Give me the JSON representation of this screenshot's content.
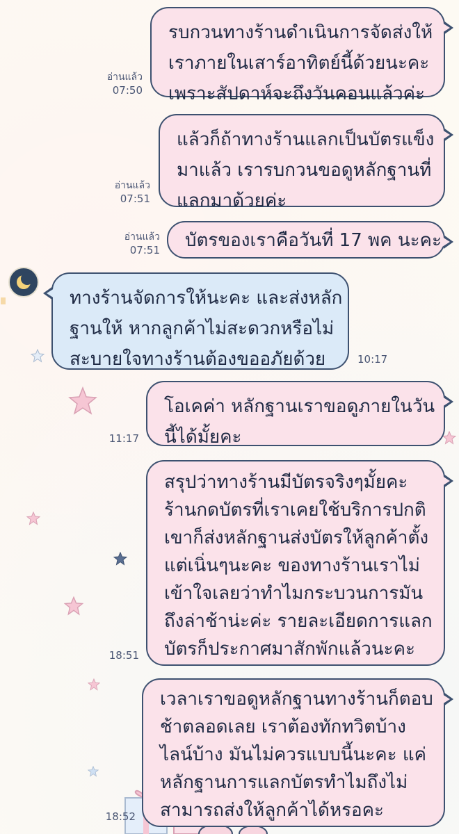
{
  "colors": {
    "outgoing_bubble": "#fbe2ea",
    "incoming_bubble": "#dbeaf8",
    "bubble_border": "#3d5170",
    "background": "#fdfaf3"
  },
  "partner": {
    "avatar_icon": "crescent-moon-icon"
  },
  "messages": [
    {
      "direction": "out",
      "read": "อ่านแล้ว",
      "time": "07:50",
      "lines": [
        "รบกวนทางร้านดำเนินการจัดส่งให้",
        "เราภายในเสาร์อาทิตย์นี้ด้วยนะคะ",
        "เพราะสัปดาห์จะถึงวันคอนแล้วค่ะ"
      ]
    },
    {
      "direction": "out",
      "read": "อ่านแล้ว",
      "time": "07:51",
      "lines": [
        "แล้วก็ถ้าทางร้านแลกเป็นบัตรแข็ง",
        "มาแล้ว เรารบกวนขอดูหลักฐานที่",
        "แลกมาด้วยค่ะ"
      ]
    },
    {
      "direction": "out",
      "read": "อ่านแล้ว",
      "time": "07:51",
      "lines": [
        "บัตรของเราคือวันที่ 17 พค นะคะ"
      ]
    },
    {
      "direction": "in",
      "time": "10:17",
      "lines": [
        "ทางร้านจัดการให้นะคะ และส่งหลัก",
        "ฐานให้ หากลูกค้าไม่สะดวกหรือไม่",
        "สะบายใจทางร้านต้องขออภัยด้วย"
      ]
    },
    {
      "direction": "out",
      "time": "11:17",
      "lines": [
        "โอเคค่า หลักฐานเราขอดูภายในวัน",
        "นี้ได้มั้ยคะ"
      ]
    },
    {
      "direction": "out",
      "time": "18:51",
      "lines": [
        "สรุปว่าทางร้านมีบัตรจริงๆมั้ยคะ",
        "ร้านกดบัตรที่เราเคยใช้บริการปกติ",
        "เขาก็ส่งหลักฐานส่งบัตรให้ลูกค้าตั้ง",
        "แต่เนิ่นๆนะคะ ของทางร้านเราไม่",
        "เข้าใจเลยว่าทำไมกระบวนการมัน",
        "ถึงล่าช้าน่ะค่ะ รายละเอียดการแลก",
        "บัตรก็ประกาศมาสักพักแล้วนะคะ"
      ]
    },
    {
      "direction": "out",
      "time": "18:52",
      "lines": [
        "เวลาเราขอดูหลักฐานทางร้านก็ตอบ",
        "ช้าตลอดเลย เราต้องทักทวิตบ้าง",
        "ไลน์บ้าง มันไม่ควรแบบนี้นะคะ แค่",
        "หลักฐานการแลกบัตรทำไมถึงไม่",
        "สามารถส่งให้ลูกค้าได้หรอคะ"
      ]
    }
  ]
}
